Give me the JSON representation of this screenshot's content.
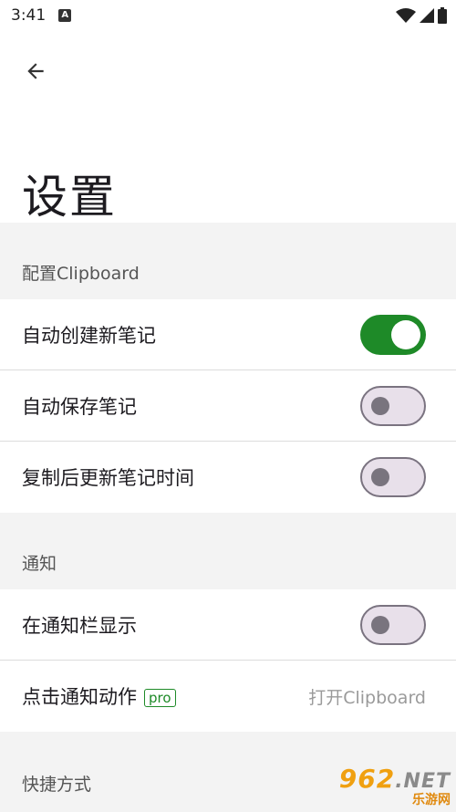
{
  "status_bar": {
    "time": "3:41",
    "notification_icon_letter": "A"
  },
  "page": {
    "title": "设置"
  },
  "sections": {
    "clipboard": {
      "header": "配置Clipboard",
      "items": [
        {
          "label": "自动创建新笔记",
          "toggle": "on"
        },
        {
          "label": "自动保存笔记",
          "toggle": "off"
        },
        {
          "label": "复制后更新笔记时间",
          "toggle": "off"
        }
      ]
    },
    "notification": {
      "header": "通知",
      "show_in_bar": {
        "label": "在通知栏显示",
        "toggle": "off"
      },
      "click_action": {
        "label": "点击通知动作",
        "badge": "pro",
        "value": "打开Clipboard"
      }
    },
    "shortcuts": {
      "header": "快捷方式"
    }
  },
  "watermark": {
    "main": "962",
    "net": ".NET",
    "sub": "乐游网"
  },
  "colors": {
    "accent": "#1e8a28",
    "toggle_off_track": "#e8e0ea",
    "toggle_off_knob": "#79747e",
    "section_bg": "#f3f3f3"
  }
}
